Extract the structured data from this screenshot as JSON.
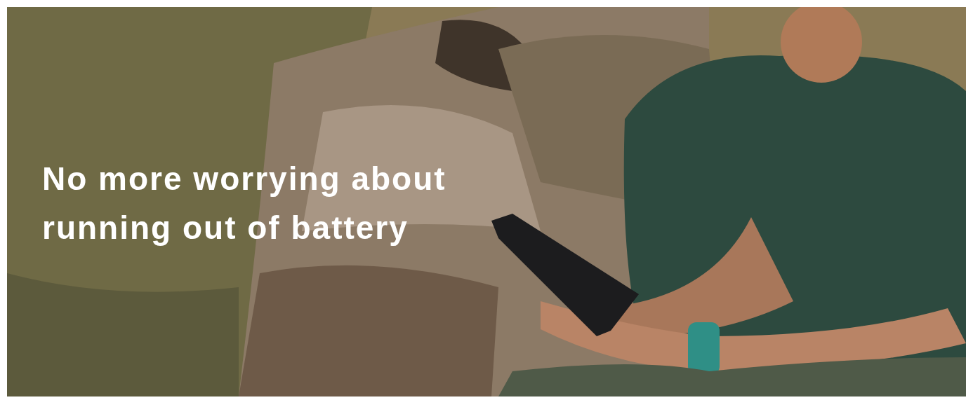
{
  "banner": {
    "headline": "No more worrying about running out of battery"
  }
}
